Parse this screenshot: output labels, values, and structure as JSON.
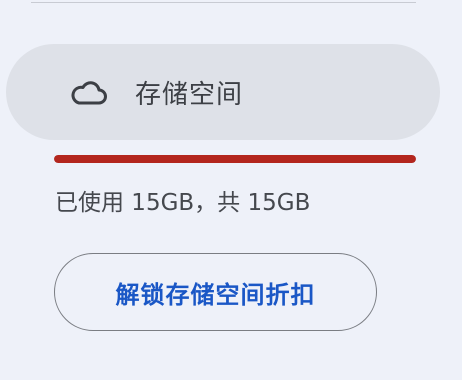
{
  "storage": {
    "label": "存储空间",
    "icon": "cloud-icon",
    "usage_text": "已使用 15GB，共 15GB",
    "used_fraction": 1.0,
    "bar_fill_color": "#b3261e",
    "unlock_button_label": "解锁存储空间折扣"
  }
}
